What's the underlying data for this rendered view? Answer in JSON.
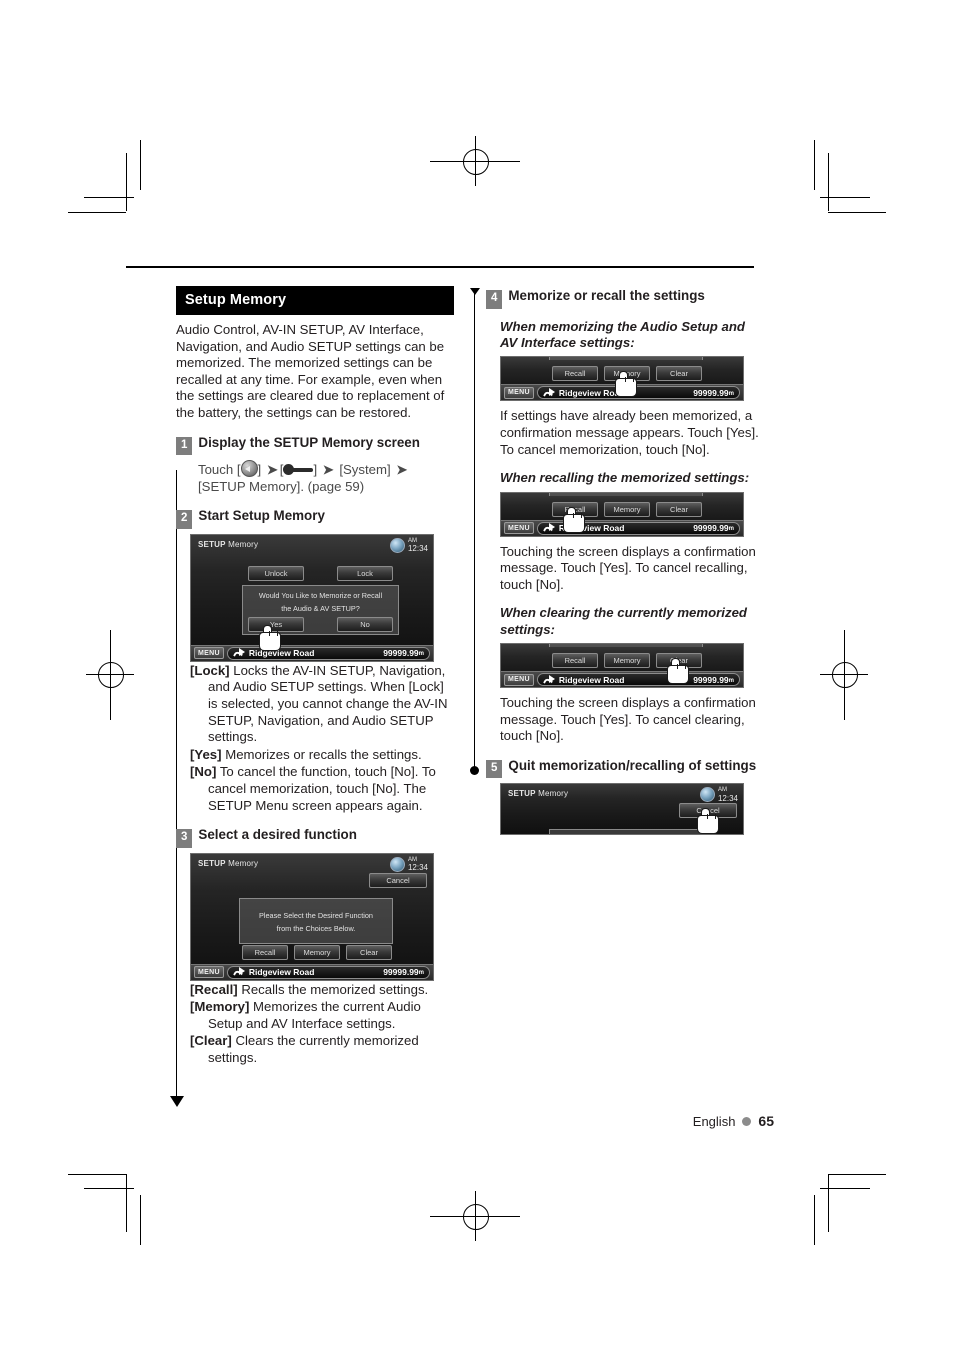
{
  "page": {
    "language_label": "English",
    "page_number": "65"
  },
  "left_column": {
    "section_title": "Setup Memory",
    "intro": "Audio Control, AV-IN SETUP, AV Interface, Navigation, and Audio SETUP settings can be memorized. The memorized settings can be recalled at any time. For example, even when the settings are cleared due to replacement of the battery, the settings can be restored.",
    "step1": {
      "num": "1",
      "title": "Display the SETUP Memory screen",
      "touch_prefix": "Touch [",
      "globe_icon": "globe-icon",
      "mid1": "] ",
      "slider_icon": "slider-icon",
      "system_label": "[System]",
      "setup_memory_label": "[SETUP Memory]. (page 59)",
      "separator": "➤"
    },
    "step2": {
      "num": "2",
      "title": "Start Setup Memory",
      "screen": {
        "title_bold": "SETUP",
        "title_rest": " Memory",
        "time": "12:34",
        "meridiem": "AM",
        "unlock_button": "Unlock",
        "lock_button": "Lock",
        "dialog_line1": "Would You Like to Memorize or Recall",
        "dialog_line2": "the Audio & AV SETUP?",
        "yes_button": "Yes",
        "no_button": "No",
        "menu_button": "MENU",
        "road": "Ridgeview Road",
        "distance": "99999.99",
        "distance_unit": "m"
      },
      "definitions": [
        {
          "term": "[Lock]",
          "text": "Locks the AV-IN SETUP, Navigation, and Audio SETUP settings. When [Lock] is selected, you cannot change the AV-IN SETUP, Navigation, and Audio SETUP settings."
        },
        {
          "term": "[Yes]",
          "text": "Memorizes or recalls the settings."
        },
        {
          "term": "[No]",
          "text": "To cancel the function, touch [No]. To cancel memorization, touch [No]. The SETUP Menu screen appears again."
        }
      ]
    },
    "step3": {
      "num": "3",
      "title": "Select a desired function",
      "screen": {
        "title_bold": "SETUP",
        "title_rest": " Memory",
        "time": "12:34",
        "meridiem": "AM",
        "cancel_button": "Cancel",
        "dialog_line1": "Please Select the Desired Function",
        "dialog_line2": "from the Choices Below.",
        "recall_button": "Recall",
        "memory_button": "Memory",
        "clear_button": "Clear",
        "menu_button": "MENU",
        "road": "Ridgeview Road",
        "distance": "99999.99",
        "distance_unit": "m"
      },
      "definitions": [
        {
          "term": "[Recall]",
          "text": "Recalls the memorized settings."
        },
        {
          "term": "[Memory]",
          "text": "Memorizes the current Audio Setup and AV Interface settings."
        },
        {
          "term": "[Clear]",
          "text": "Clears the currently memorized settings."
        }
      ]
    }
  },
  "right_column": {
    "step4": {
      "num": "4",
      "title": "Memorize or recall the settings",
      "sub1": {
        "heading": "When memorizing the Audio Setup and AV Interface settings:",
        "screen": {
          "recall_button": "Recall",
          "memory_button": "Memory",
          "clear_button": "Clear",
          "menu_button": "MENU",
          "road": "Ridgeview Road",
          "distance": "99999.99",
          "distance_unit": "m"
        },
        "text": "If settings have already been memorized, a confirmation message appears. Touch [Yes]. To cancel memorization, touch [No]."
      },
      "sub2": {
        "heading": "When recalling the memorized settings:",
        "screen": {
          "recall_button": "Recall",
          "memory_button": "Memory",
          "clear_button": "Clear",
          "menu_button": "MENU",
          "road": "Ridgeview Road",
          "distance": "99999.99",
          "distance_unit": "m"
        },
        "text": "Touching the screen displays a confirmation message. Touch [Yes]. To cancel recalling, touch [No]."
      },
      "sub3": {
        "heading": "When clearing the currently memorized settings:",
        "screen": {
          "recall_button": "Recall",
          "memory_button": "Memory",
          "clear_button": "Clear",
          "menu_button": "MENU",
          "road": "Ridgeview Road",
          "distance": "99999.99",
          "distance_unit": "m"
        },
        "text": "Touching the screen displays a confirmation message. Touch [Yes]. To cancel clearing, touch [No]."
      }
    },
    "step5": {
      "num": "5",
      "title": "Quit memorization/recalling of settings",
      "screen": {
        "title_bold": "SETUP",
        "title_rest": " Memory",
        "time": "12:34",
        "meridiem": "AM",
        "cancel_button": "Cancel"
      }
    }
  }
}
